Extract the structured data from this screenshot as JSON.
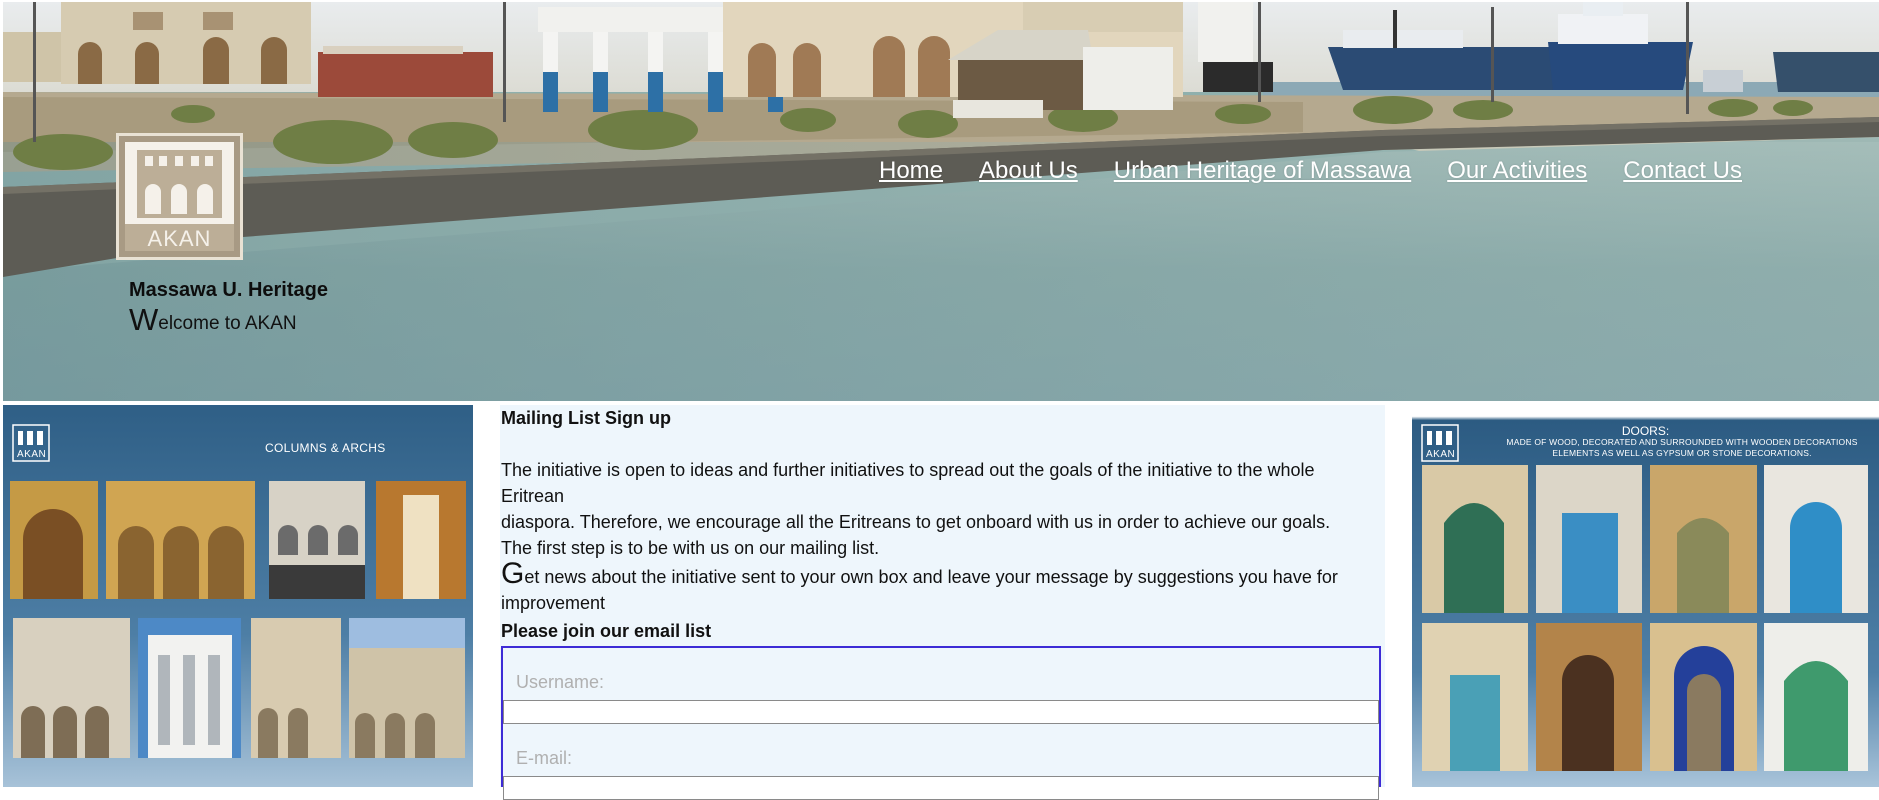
{
  "header": {
    "brand_title": "Massawa U. Heritage",
    "welcome_first": "W",
    "welcome_rest": "elcome to AKAN",
    "logo_text": "AKAN"
  },
  "nav": {
    "items": [
      {
        "label": "Home"
      },
      {
        "label": "About Us"
      },
      {
        "label": "Urban Heritage of Massawa"
      },
      {
        "label": "Our Activities"
      },
      {
        "label": "Contact Us"
      }
    ]
  },
  "left_panel": {
    "logo_text": "AKAN",
    "caption": "COLUMNS & ARCHS"
  },
  "right_panel": {
    "logo_text": "AKAN",
    "title": "DOORS:",
    "description": "MADE OF WOOD, DECORATED AND SURROUNDED WITH WOODEN DECORATIONS ELEMENTS AS WELL AS GYPSUM OR STONE DECORATIONS."
  },
  "signup": {
    "title": "Mailing List Sign up",
    "paragraph1": "The initiative is open to ideas and further initiatives to spread out the goals of the initiative to the whole Eritrean diaspora. Therefore, we encourage all the Eritreans to get onboard with us in order to achieve our goals. The first step is to be with us on our mailing list.",
    "paragraph1_line1": "The initiative is open to ideas and further initiatives to spread out the goals of the initiative to the whole Eritrean",
    "paragraph1_line2": "diaspora. Therefore, we encourage all the Eritreans to get onboard with us in order to achieve our goals.",
    "paragraph1_line3": "The first step is to be with us on our mailing list.",
    "paragraph2_first": "G",
    "paragraph2_rest": "et news about the initiative sent to your own box and leave your message by suggestions you have for improvement",
    "join_label": "Please join our email list",
    "username_placeholder": "Username:",
    "email_placeholder": "E-mail:"
  },
  "colors": {
    "accent_border": "#3d2bd6",
    "center_bg": "#eef6fc",
    "panel_blue": "#2e5f86"
  }
}
